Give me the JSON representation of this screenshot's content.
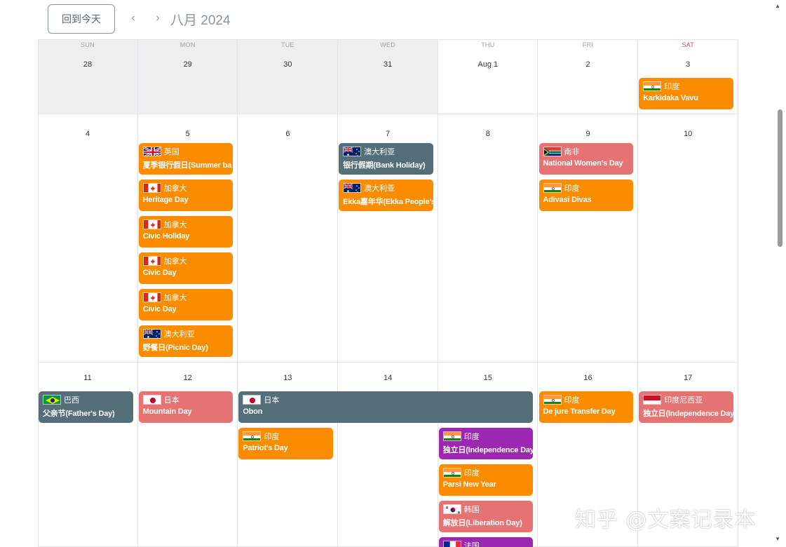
{
  "toolbar": {
    "today_label": "回到今天",
    "prev_label": "‹",
    "next_label": "›",
    "month_title": "八月 2024"
  },
  "weekdays": [
    "SUN",
    "MON",
    "TUE",
    "WED",
    "THU",
    "FRI",
    "SAT"
  ],
  "weeks": [
    {
      "days": [
        "28",
        "29",
        "30",
        "31",
        "Aug 1",
        "2",
        "3"
      ],
      "outside_month": [
        true,
        true,
        true,
        true,
        false,
        false,
        false
      ]
    },
    {
      "days": [
        "4",
        "5",
        "6",
        "7",
        "8",
        "9",
        "10"
      ]
    },
    {
      "days": [
        "11",
        "12",
        "13",
        "14",
        "15",
        "16",
        "17"
      ]
    }
  ],
  "events": [
    {
      "week": 0,
      "col": 6,
      "slot": 0,
      "span": 1,
      "flag": "india",
      "country": "印度",
      "title": "Karkidaka Vavu",
      "color": "#fb8c00"
    },
    {
      "week": 1,
      "col": 1,
      "slot": 0,
      "span": 1,
      "flag": "uk",
      "country": "英国",
      "title": "夏季银行假日(Summer ba",
      "color": "#fb8c00"
    },
    {
      "week": 1,
      "col": 1,
      "slot": 1,
      "span": 1,
      "flag": "canada",
      "country": "加拿大",
      "title": "Heritage Day",
      "color": "#fb8c00"
    },
    {
      "week": 1,
      "col": 1,
      "slot": 2,
      "span": 1,
      "flag": "canada",
      "country": "加拿大",
      "title": "Civic Holiday",
      "color": "#fb8c00"
    },
    {
      "week": 1,
      "col": 1,
      "slot": 3,
      "span": 1,
      "flag": "canada",
      "country": "加拿大",
      "title": "Civic Day",
      "color": "#fb8c00"
    },
    {
      "week": 1,
      "col": 1,
      "slot": 4,
      "span": 1,
      "flag": "canada",
      "country": "加拿大",
      "title": "Civic Day",
      "color": "#fb8c00"
    },
    {
      "week": 1,
      "col": 1,
      "slot": 5,
      "span": 1,
      "flag": "australia",
      "country": "澳大利亚",
      "title": "野餐日(Picnic Day)",
      "color": "#fb8c00"
    },
    {
      "week": 1,
      "col": 3,
      "slot": 0,
      "span": 1,
      "flag": "australia",
      "country": "澳大利亚",
      "title": "银行假期(Bank Holiday)",
      "color": "#546e7a"
    },
    {
      "week": 1,
      "col": 3,
      "slot": 1,
      "span": 1,
      "flag": "australia",
      "country": "澳大利亚",
      "title": "Ekka嘉年华(Ekka People's",
      "color": "#fb8c00"
    },
    {
      "week": 1,
      "col": 5,
      "slot": 0,
      "span": 1,
      "flag": "southafrica",
      "country": "南非",
      "title": "National Women's Day",
      "color": "#e57373"
    },
    {
      "week": 1,
      "col": 5,
      "slot": 1,
      "span": 1,
      "flag": "india",
      "country": "印度",
      "title": "Adivasi Divas",
      "color": "#fb8c00"
    },
    {
      "week": 2,
      "col": 0,
      "slot": 0,
      "span": 1,
      "flag": "brazil",
      "country": "巴西",
      "title": "父亲节(Father's Day)",
      "color": "#546e7a"
    },
    {
      "week": 2,
      "col": 1,
      "slot": 0,
      "span": 1,
      "flag": "japan",
      "country": "日本",
      "title": "Mountain Day",
      "color": "#e57373"
    },
    {
      "week": 2,
      "col": 2,
      "slot": 0,
      "span": 3,
      "flag": "japan",
      "country": "日本",
      "title": "Obon",
      "color": "#546e7a"
    },
    {
      "week": 2,
      "col": 2,
      "slot": 1,
      "span": 1,
      "flag": "india",
      "country": "印度",
      "title": "Patriot's Day",
      "color": "#fb8c00"
    },
    {
      "week": 2,
      "col": 4,
      "slot": 1,
      "span": 1,
      "flag": "india",
      "country": "印度",
      "title": "独立日(Independence Day",
      "color": "#9c27b0"
    },
    {
      "week": 2,
      "col": 4,
      "slot": 2,
      "span": 1,
      "flag": "india",
      "country": "印度",
      "title": "Parsi New Year",
      "color": "#fb8c00"
    },
    {
      "week": 2,
      "col": 4,
      "slot": 3,
      "span": 1,
      "flag": "korea",
      "country": "韩国",
      "title": "解放日(Liberation Day)",
      "color": "#e57373"
    },
    {
      "week": 2,
      "col": 4,
      "slot": 4,
      "span": 1,
      "flag": "france",
      "country": "法国",
      "title": "",
      "color": "#9c27b0"
    },
    {
      "week": 2,
      "col": 5,
      "slot": 0,
      "span": 1,
      "flag": "india",
      "country": "印度",
      "title": "De jure Transfer Day",
      "color": "#fb8c00"
    },
    {
      "week": 2,
      "col": 6,
      "slot": 0,
      "span": 1,
      "flag": "indonesia",
      "country": "印度尼西亚",
      "title": "独立日(Independence Day",
      "color": "#e57373"
    }
  ],
  "watermark": "知乎 @文案记录本",
  "scrollbar": {
    "up_icon": "▲",
    "down_icon": "▼"
  }
}
